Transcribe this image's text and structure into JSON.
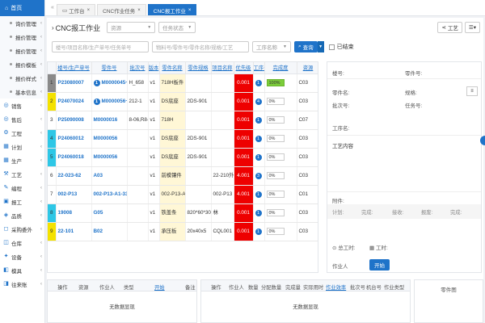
{
  "sidebar": {
    "top_label": "首页",
    "items": [
      {
        "label": "询价管理",
        "sub": true
      },
      {
        "label": "报价管理",
        "sub": true
      },
      {
        "label": "报价管理",
        "sub": true
      },
      {
        "label": "报价模板",
        "sub": true
      },
      {
        "label": "报价样式",
        "sub": true
      },
      {
        "label": "基本信息",
        "sub": true
      },
      {
        "label": "销售",
        "sub": false
      },
      {
        "label": "售后",
        "sub": false
      },
      {
        "label": "工程",
        "sub": false
      },
      {
        "label": "计划",
        "sub": false
      },
      {
        "label": "生产",
        "sub": false
      },
      {
        "label": "工艺",
        "sub": false
      },
      {
        "label": "编程",
        "sub": false
      },
      {
        "label": "报工",
        "sub": false
      },
      {
        "label": "品质",
        "sub": false
      },
      {
        "label": "采购委外",
        "sub": false
      },
      {
        "label": "仓库",
        "sub": false
      },
      {
        "label": "设备",
        "sub": false
      },
      {
        "label": "模具",
        "sub": false
      },
      {
        "label": "往来账",
        "sub": false
      }
    ]
  },
  "tabs": [
    {
      "label": "工作台",
      "active": false
    },
    {
      "label": "CNC作业任务",
      "active": false
    },
    {
      "label": "CNC报工作业",
      "active": true
    }
  ],
  "header": {
    "title": "CNC报工作业",
    "select_resource": "资源",
    "select_status": "任务状态",
    "tool_process": "工艺"
  },
  "filters": {
    "order_placeholder": "楼号/项目名称/生产单号/任务单号",
    "part_placeholder": "物料号/零件号/零件名称/规格/工艺",
    "process_name": "工序名称",
    "query_label": "查询",
    "finished_label": "已结束"
  },
  "table": {
    "columns": [
      "",
      "楼号/生产单号",
      "零件号",
      "批次号",
      "版本",
      "零件名称",
      "零件规格",
      "项目名称",
      "优先级",
      "工序号",
      "完成度",
      "资源"
    ],
    "rows": [
      {
        "idx": "1",
        "color": "#8a8a8a",
        "order": "P23080007",
        "part_icon": "1",
        "part": "M0000045~M0000069",
        "batch": "H_658",
        "ver": "v1",
        "name": "718H板件",
        "spec": "",
        "project": "",
        "prio": "0.001",
        "step": "1",
        "progress": "100%",
        "full": true,
        "res": "C03"
      },
      {
        "idx": "2",
        "color": "#f4e200",
        "order": "P24070024",
        "part_icon": "1",
        "part": "M0000056~A01",
        "batch": "212-1",
        "ver": "v1",
        "name": "DS底座",
        "spec": "2DS-901",
        "project": "",
        "prio": "0.001",
        "step": "4",
        "progress": "0%",
        "full": false,
        "res": "C03"
      },
      {
        "idx": "3",
        "color": "#ffffff",
        "order": "P25090008",
        "part_icon": "",
        "part": "M0000016",
        "batch": "8-06,R8-02,R8-05,R8",
        "ver": "v1",
        "name": "718H",
        "spec": "",
        "project": "",
        "prio": "0.001",
        "step": "1",
        "progress": "0%",
        "full": false,
        "res": "C07"
      },
      {
        "idx": "4",
        "color": "#2ec7e6",
        "order": "P24060012",
        "part_icon": "",
        "part": "M0000056",
        "batch": "",
        "ver": "v1",
        "name": "DS底座",
        "spec": "2DS-901",
        "project": "",
        "prio": "0.001",
        "step": "1",
        "progress": "0%",
        "full": false,
        "res": "C03"
      },
      {
        "idx": "5",
        "color": "#2ec7e6",
        "order": "P24060018",
        "part_icon": "",
        "part": "M0000056",
        "batch": "",
        "ver": "v1",
        "name": "DS底座",
        "spec": "2DS-901",
        "project": "",
        "prio": "0.001",
        "step": "1",
        "progress": "0%",
        "full": false,
        "res": "C03"
      },
      {
        "idx": "6",
        "color": "#ffffff",
        "order": "22-023-62",
        "part_icon": "",
        "part": "A03",
        "batch": "",
        "ver": "v1",
        "name": "前模镶件",
        "spec": "",
        "project": "22-210外壳",
        "prio": "4.001",
        "step": "3",
        "progress": "0%",
        "full": false,
        "res": "C03"
      },
      {
        "idx": "7",
        "color": "#ffffff",
        "order": "002-P13",
        "part_icon": "",
        "part": "002-P13-A1-33F1",
        "batch": "",
        "ver": "v1",
        "name": "002-P13-A1-33",
        "spec": "",
        "project": "002-P13",
        "prio": "4.001",
        "step": "1",
        "progress": "0%",
        "full": false,
        "res": "C01"
      },
      {
        "idx": "8",
        "color": "#2ec7e6",
        "order": "19008",
        "part_icon": "",
        "part": "G05",
        "batch": "",
        "ver": "v1",
        "name": "铁盖条",
        "spec": "820*60*30",
        "project": "林",
        "prio": "0.001",
        "step": "1",
        "progress": "0%",
        "full": false,
        "res": "C03"
      },
      {
        "idx": "9",
        "color": "#f4e200",
        "order": "22-101",
        "part_icon": "",
        "part": "B02",
        "batch": "",
        "ver": "v1",
        "name": "承压板",
        "spec": "20x40x5",
        "project": "CQL001",
        "prio": "0.001",
        "step": "1",
        "progress": "0%",
        "full": false,
        "res": "C03"
      }
    ]
  },
  "detail": {
    "building": "楼号:",
    "part_no": "零件号:",
    "part_name": "零件名:",
    "spec": "规格:",
    "batch": "批次号:",
    "task": "任务号:",
    "process": "工序名:",
    "content": "工艺内容",
    "attach": "附件:",
    "h_plan": "计划:",
    "h_done": "完成:",
    "h_recv": "接收:",
    "h_scrap": "报废:",
    "h_fin": "完成:",
    "start_time": "总工时:",
    "end_time": "工时:",
    "worker": "作业人",
    "start_btn": "开始"
  },
  "bottom_left": {
    "cols": [
      "操作",
      "资源",
      "作业人",
      "类型",
      "开始",
      "备注"
    ],
    "empty": "无数据显现"
  },
  "bottom_mid": {
    "cols": [
      "操作",
      "作业人",
      "数量",
      "分配数量",
      "完成量",
      "实际用时",
      "作业效率",
      "批次号",
      "机台号",
      "作业类型"
    ],
    "empty": "无数据显现"
  },
  "bottom_right": {
    "title": "零件图"
  }
}
